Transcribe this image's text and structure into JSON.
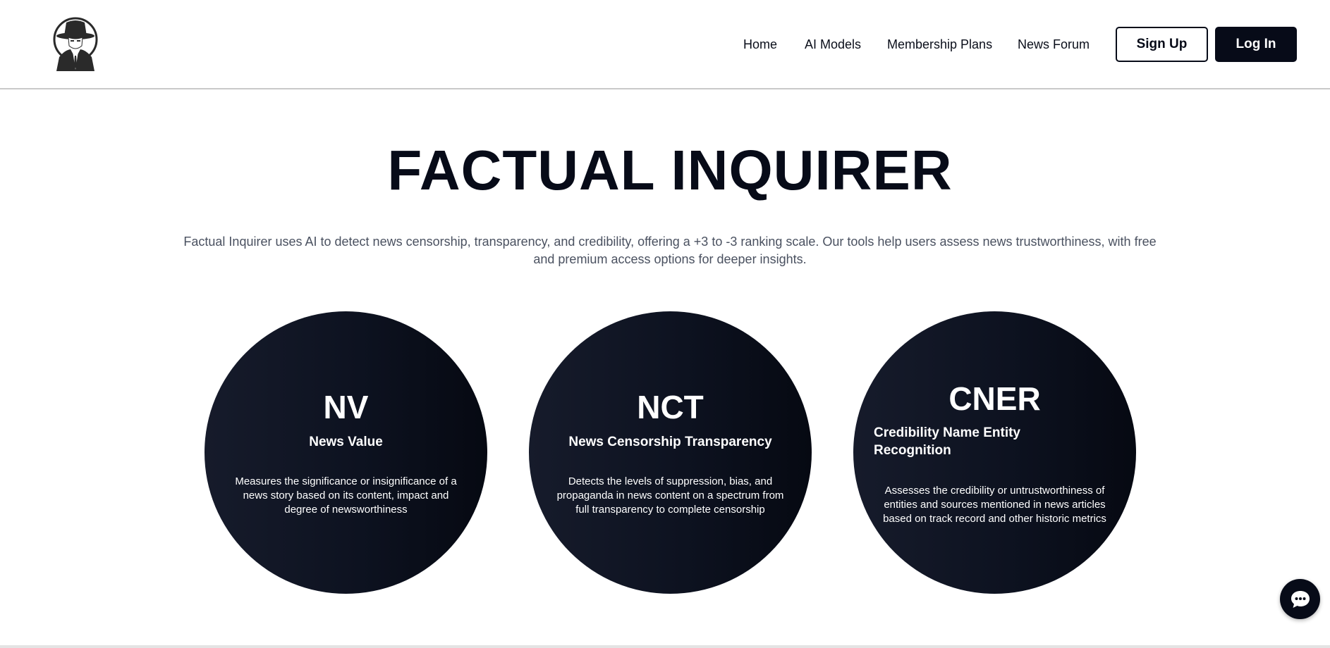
{
  "header": {
    "logo_icon": "detective-hat-silhouette-icon",
    "nav": {
      "home": "Home",
      "ai_models": "AI Models",
      "membership_plans": "Membership Plans",
      "news_forum": "News Forum"
    },
    "sign_up": "Sign Up",
    "log_in": "Log In"
  },
  "hero": {
    "title": "FACTUAL INQUIRER",
    "description": "Factual Inquirer uses AI to detect news censorship, transparency, and credibility, offering a +3 to -3 ranking scale. Our tools help users assess news trustworthiness, with free and premium access options for deeper insights."
  },
  "models": [
    {
      "abbr": "NV",
      "name": "News Value",
      "description": "Measures the significance or insignificance of a news story based on its content, impact and degree of newsworthiness"
    },
    {
      "abbr": "NCT",
      "name": "News Censorship Transparency",
      "description": "Detects the levels of suppression, bias, and propaganda in news content on a spectrum from full transparency to complete censorship"
    },
    {
      "abbr": "CNER",
      "name": "Credibility Name Entity Recognition",
      "description": "Assesses the credibility or untrustworthiness of entities and sources mentioned in news articles based on track record and other historic metrics"
    }
  ],
  "chat": {
    "icon": "chat-bubble-icon"
  },
  "colors": {
    "primary": "#070b18",
    "text_muted": "#4a5160",
    "circle_light": "#161b2b",
    "circle_dark": "#060912"
  }
}
